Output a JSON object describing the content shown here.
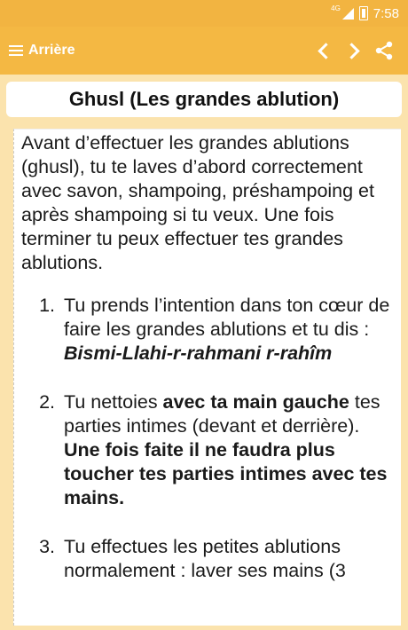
{
  "status_bar": {
    "network": "4G",
    "time": "7:58"
  },
  "app_bar": {
    "back_label": "Arrière"
  },
  "title": "Ghusl (Les grandes ablution)",
  "content": {
    "intro": "Avant d’effectuer les grandes ablutions (ghusl), tu te laves d’abord correctement avec savon, shampoing, préshampoing et après shampoing si tu veux. Une fois terminer tu peux effectuer tes grandes ablutions.",
    "steps": [
      {
        "text": "Tu prends l’intention dans ton cœur de faire les grandes ablutions et tu dis : ",
        "bold_italic": "Bismi-Llahi-r-rahmani r-rahîm"
      },
      {
        "text_a": "Tu nettoies ",
        "bold_a": "avec ta main gauche",
        "text_b": " tes parties intimes (devant et derrière). ",
        "bold_b": "Une fois faite il ne faudra plus toucher tes parties intimes avec tes mains."
      },
      {
        "text": "Tu effectues les petites ablutions normalement : laver ses mains (3"
      }
    ]
  },
  "colors": {
    "primary": "#f4b843",
    "status": "#f2b441",
    "background": "#fbe3ad"
  }
}
